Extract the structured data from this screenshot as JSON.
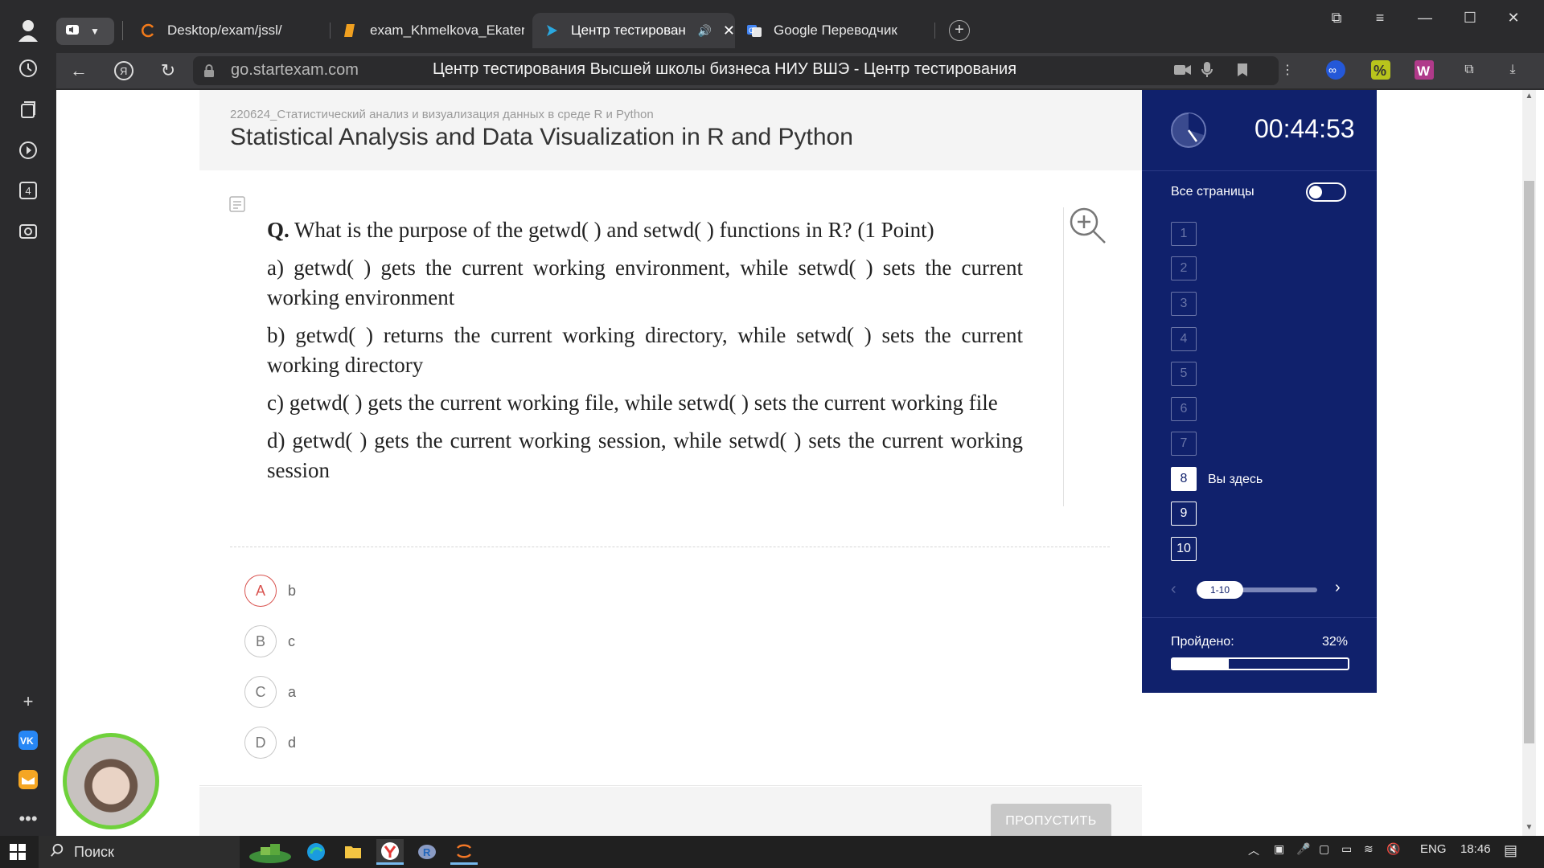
{
  "browser": {
    "tabs": [
      {
        "title": "Desktop/exam/jssl/",
        "active": false
      },
      {
        "title": "exam_Khmelkova_Ekaterina",
        "active": false
      },
      {
        "title": "Центр тестирования",
        "active": true
      },
      {
        "title": "Google Переводчик",
        "active": false
      }
    ],
    "url_domain": "go.startexam.com",
    "url_title": "Центр тестирования Высшей школы бизнеса НИУ ВШЭ - Центр тестирования",
    "rail_badge": "4"
  },
  "page": {
    "course_code": "220624_Статистический анализ и визуализация данных в среде R и Python",
    "course_title": "Statistical Analysis and Data Visualization in R and Python",
    "question": {
      "prefix": "Q.",
      "text": "What is the purpose of the getwd( ) and setwd( ) functions in R? (1 Point)",
      "options": [
        "a) getwd( ) gets the current working environment, while setwd( ) sets the current working environment",
        "b) getwd( ) returns the current working directory, while setwd( ) sets the current working directory",
        "c) getwd( ) gets the current working file, while setwd( ) sets the current working file",
        "d) getwd( ) gets the current working session, while setwd( ) sets the current working session"
      ]
    },
    "answers": [
      {
        "letter": "A",
        "text": "b",
        "selected": true
      },
      {
        "letter": "B",
        "text": "c",
        "selected": false
      },
      {
        "letter": "C",
        "text": "a",
        "selected": false
      },
      {
        "letter": "D",
        "text": "d",
        "selected": false
      }
    ],
    "skip_button": "ПРОПУСТИТЬ"
  },
  "panel": {
    "timer": "00:44:53",
    "all_pages_label": "Все страницы",
    "all_pages_on": false,
    "questions": [
      "1",
      "2",
      "3",
      "4",
      "5",
      "6",
      "7",
      "8",
      "9",
      "10"
    ],
    "current_question": "8",
    "here_label": "Вы здесь",
    "pager_label": "1-10",
    "progress_label": "Пройдено:",
    "progress_value": "32%",
    "progress_fraction": 0.32
  },
  "taskbar": {
    "search_label": "Поиск",
    "lang": "ENG",
    "time": "18:46"
  },
  "colors": {
    "panel_bg": "#10216c",
    "selected_answer": "#d9534f",
    "webcam_ring": "#6fd13b"
  }
}
